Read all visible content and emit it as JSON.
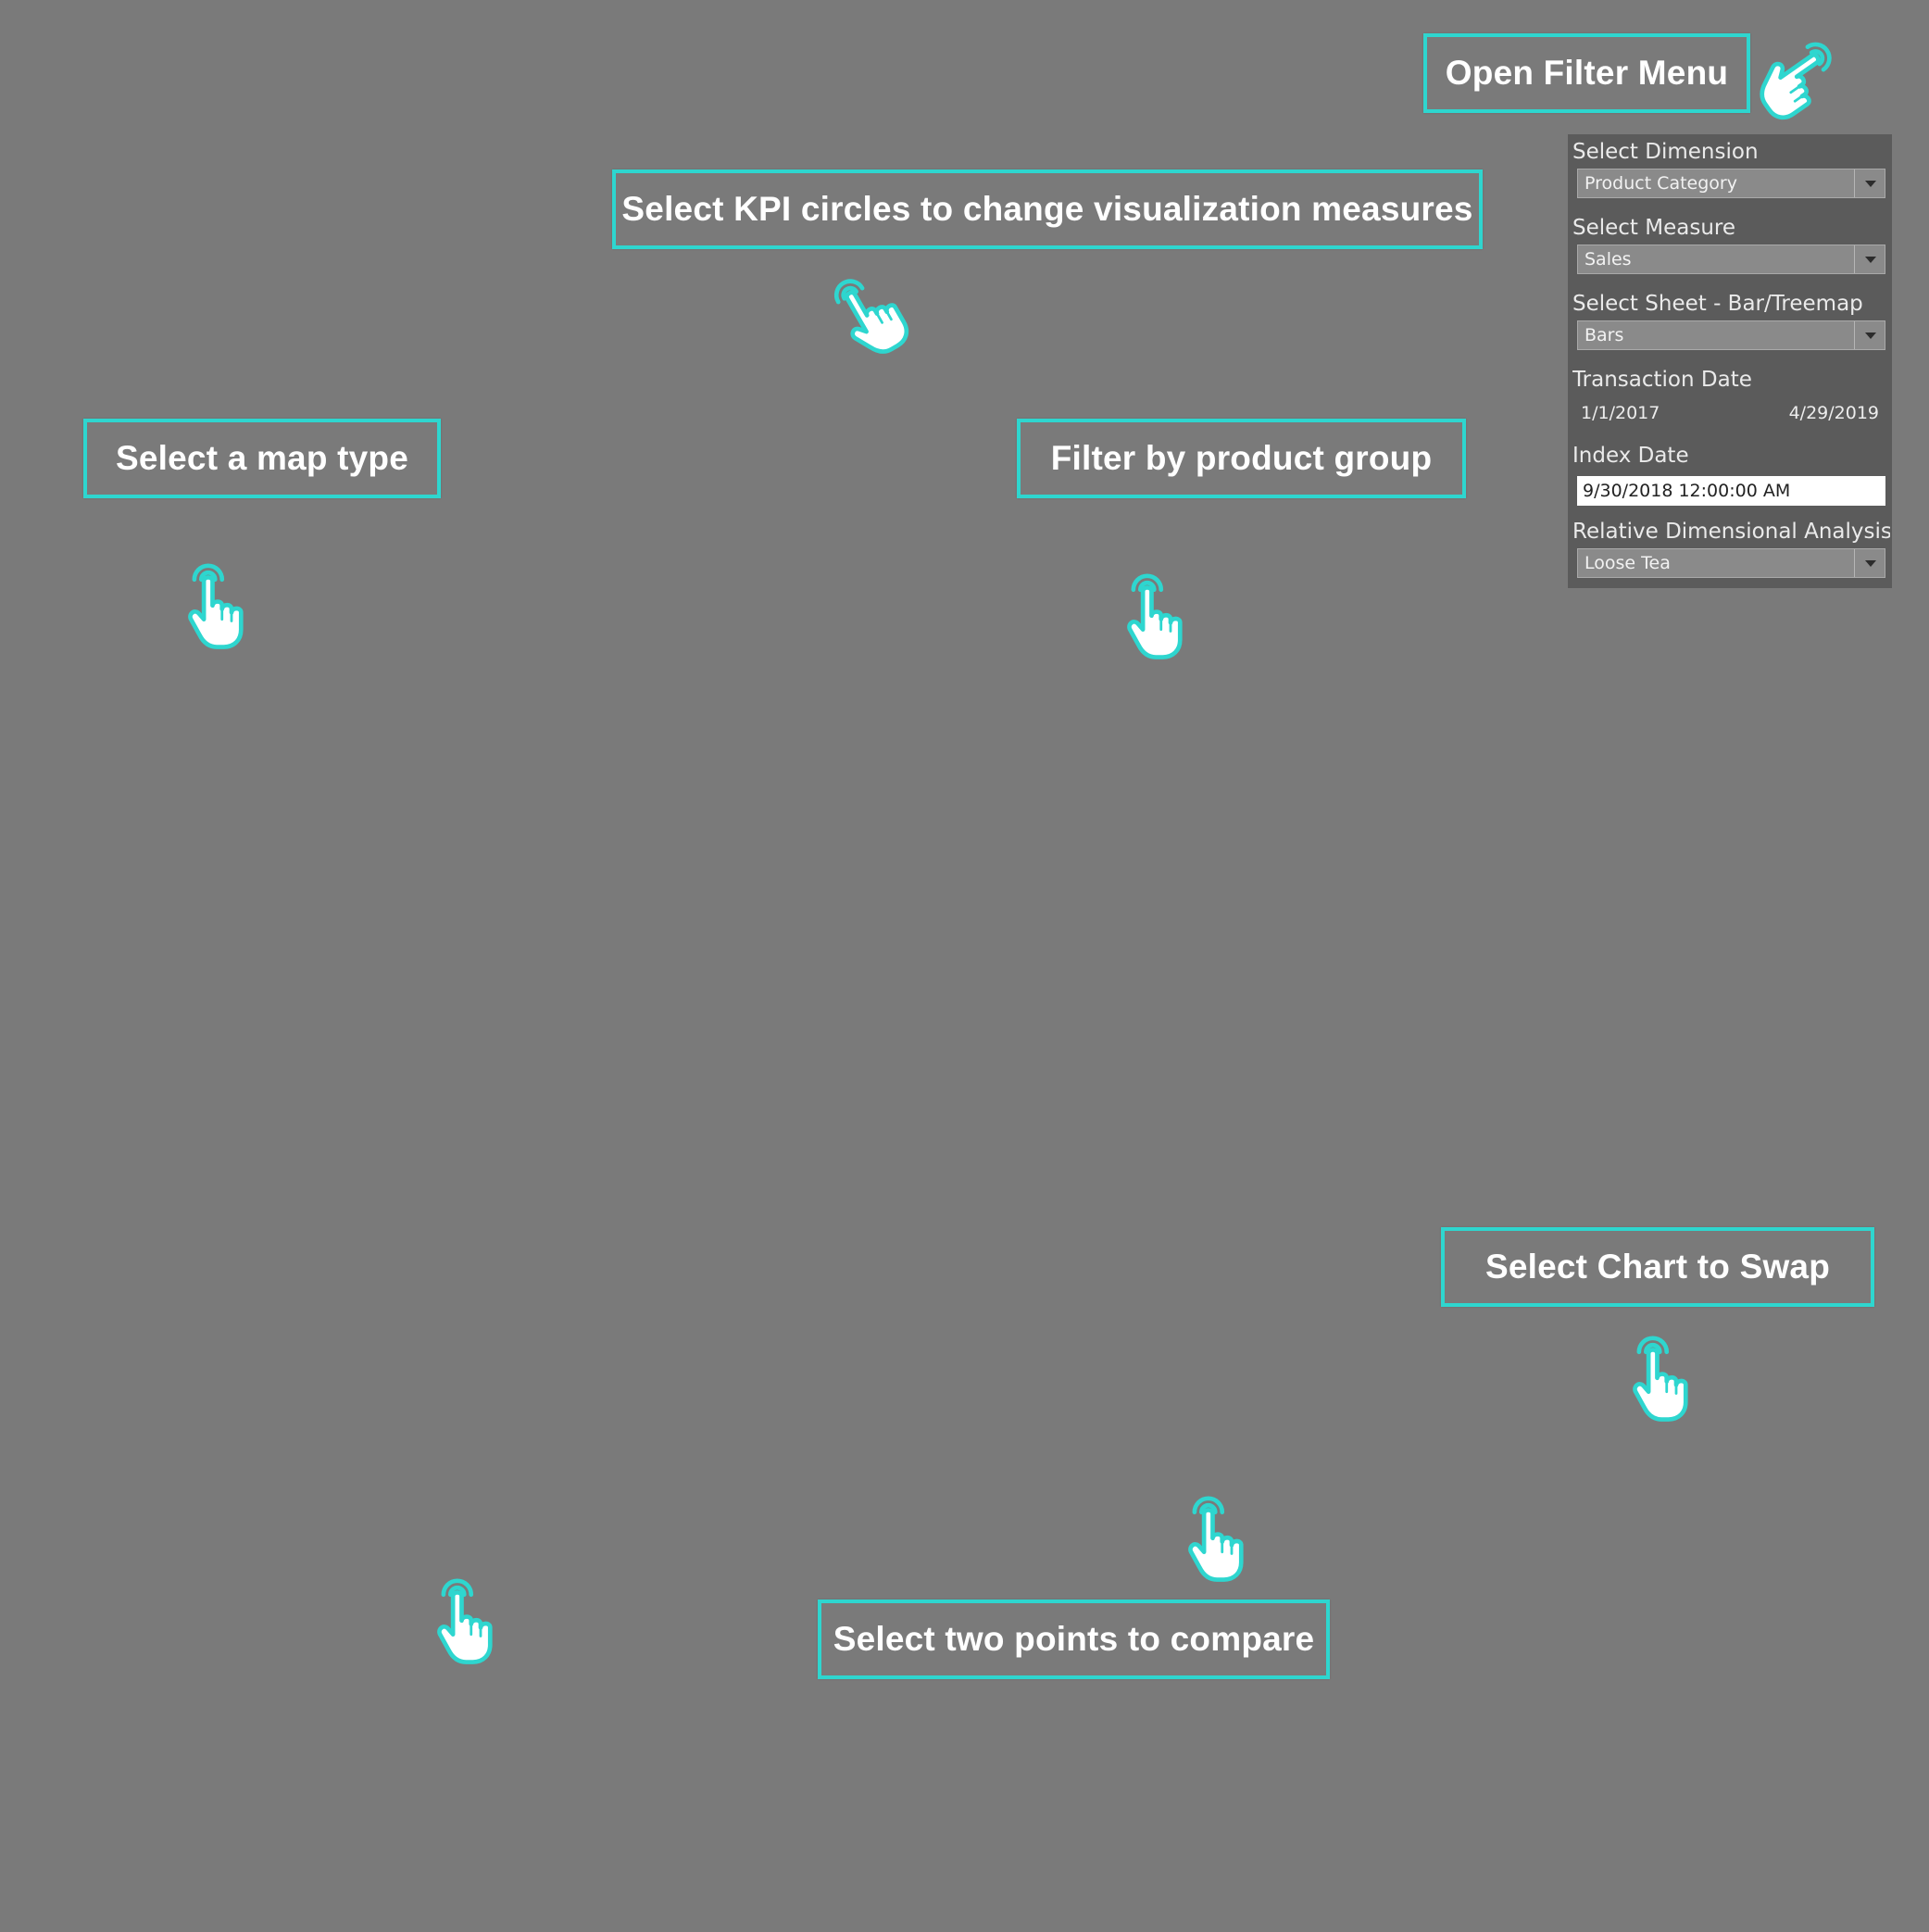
{
  "colors": {
    "background": "#7a7a7a",
    "accent": "#2ed6cf",
    "panel": "#5b5b5b"
  },
  "callouts": {
    "open_filter_menu": "Open Filter Menu",
    "kpi_circles": "Select KPI circles to change visualization measures",
    "map_type": "Select a map type",
    "product_group": "Filter by product group",
    "chart_swap": "Select Chart to Swap",
    "two_points": "Select two points to compare"
  },
  "icons": {
    "hand": "pointing-hand-icon"
  },
  "filter_panel": {
    "dimension": {
      "label": "Select Dimension",
      "value": "Product Category"
    },
    "measure": {
      "label": "Select Measure",
      "value": "Sales"
    },
    "sheet": {
      "label": "Select Sheet - Bar/Treemap",
      "value": "Bars"
    },
    "transaction_date": {
      "label": "Transaction Date",
      "start": "1/1/2017",
      "end": "4/29/2019"
    },
    "index_date": {
      "label": "Index Date",
      "value": "9/30/2018 12:00:00 AM"
    },
    "relative_analysis": {
      "label": "Relative Dimensional Analysis..",
      "value": "Loose Tea"
    }
  }
}
